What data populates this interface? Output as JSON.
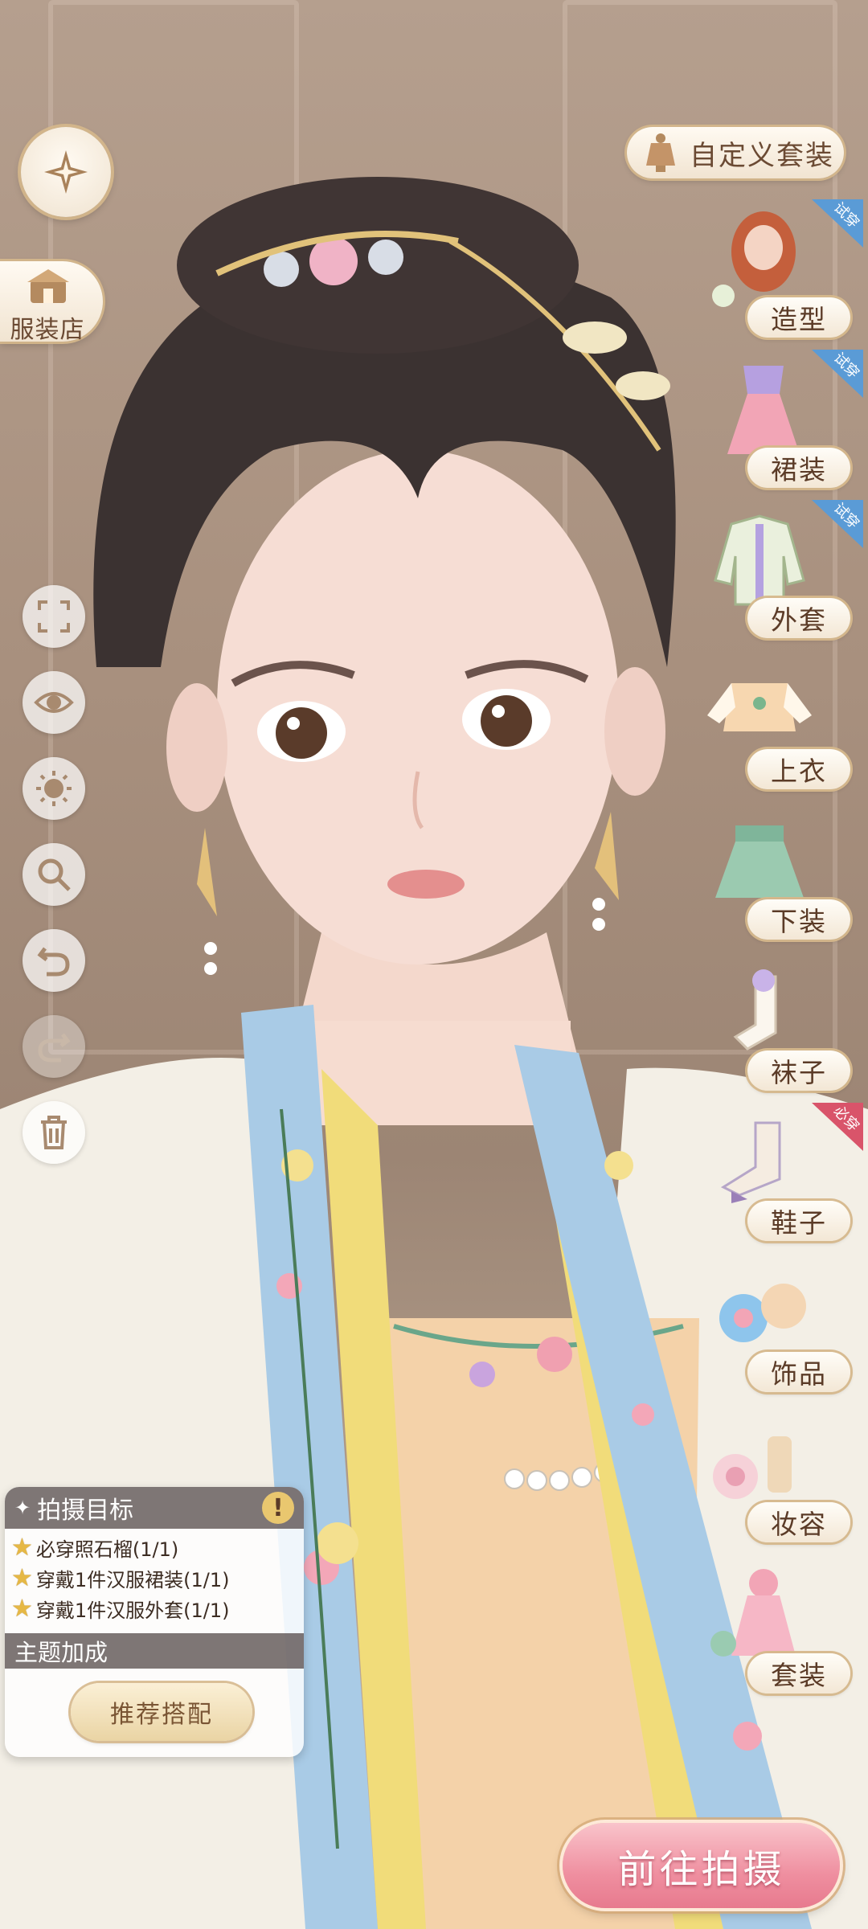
{
  "top": {
    "back_icon": "compass-star-icon",
    "shop_label": "服装店",
    "custom_outfit_label": "自定义套装"
  },
  "categories": [
    {
      "label": "造型",
      "tag": "试穿",
      "icon": "hairstyle-icon"
    },
    {
      "label": "裙装",
      "tag": "试穿",
      "icon": "dress-icon"
    },
    {
      "label": "外套",
      "tag": "试穿",
      "icon": "coat-icon"
    },
    {
      "label": "上衣",
      "tag": "",
      "icon": "top-icon"
    },
    {
      "label": "下装",
      "tag": "",
      "icon": "skirt-icon"
    },
    {
      "label": "袜子",
      "tag": "",
      "icon": "socks-icon"
    },
    {
      "label": "鞋子",
      "tag": "必穿",
      "icon": "shoes-icon"
    },
    {
      "label": "饰品",
      "tag": "",
      "icon": "accessory-icon"
    },
    {
      "label": "妆容",
      "tag": "",
      "icon": "makeup-icon"
    },
    {
      "label": "套装",
      "tag": "",
      "icon": "outfit-set-icon"
    }
  ],
  "tools": [
    {
      "name": "fullscreen-icon",
      "enabled": true
    },
    {
      "name": "eye-icon",
      "enabled": true
    },
    {
      "name": "lighting-icon",
      "enabled": true
    },
    {
      "name": "zoom-icon",
      "enabled": true
    },
    {
      "name": "undo-icon",
      "enabled": true
    },
    {
      "name": "redo-icon",
      "enabled": false
    },
    {
      "name": "trash-icon",
      "enabled": true
    }
  ],
  "target_panel": {
    "title": "拍摄目标",
    "tasks": [
      {
        "text": "必穿照石榴(1/1)"
      },
      {
        "text": "穿戴1件汉服裙装(1/1)"
      },
      {
        "text": "穿戴1件汉服外套(1/1)"
      }
    ],
    "bonus_title": "主题加成",
    "recommend_label": "推荐搭配"
  },
  "go_shoot_label": "前往拍摄",
  "colors": {
    "try_tag": "#5a9bd6",
    "must_tag": "#d9546a",
    "accent_pink": "#ef8fa0"
  }
}
